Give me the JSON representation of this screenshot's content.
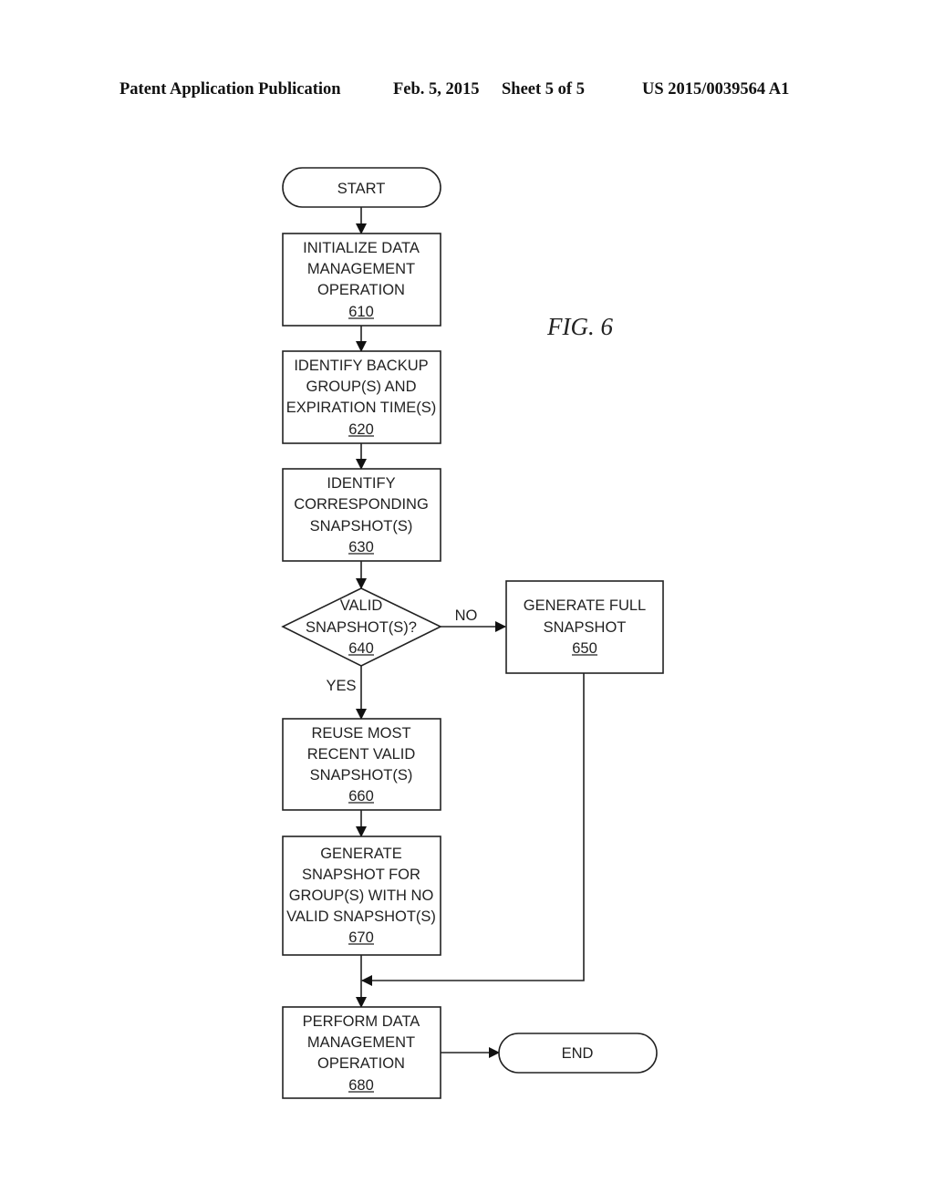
{
  "header": {
    "publication": "Patent Application Publication",
    "date": "Feb. 5, 2015",
    "sheet": "Sheet 5 of 5",
    "number": "US 2015/0039564 A1"
  },
  "figure": {
    "label": "FIG. 6"
  },
  "nodes": {
    "start": {
      "lines": [
        "START"
      ]
    },
    "n610": {
      "lines": [
        "INITIALIZE DATA",
        "MANAGEMENT",
        "OPERATION"
      ],
      "ref": "610"
    },
    "n620": {
      "lines": [
        "IDENTIFY BACKUP",
        "GROUP(S) AND",
        "EXPIRATION TIME(S)"
      ],
      "ref": "620"
    },
    "n630": {
      "lines": [
        "IDENTIFY",
        "CORRESPONDING",
        "SNAPSHOT(S)"
      ],
      "ref": "630"
    },
    "n640": {
      "lines": [
        "VALID",
        "SNAPSHOT(S)?"
      ],
      "ref": "640"
    },
    "n650": {
      "lines": [
        "GENERATE FULL",
        "SNAPSHOT"
      ],
      "ref": "650"
    },
    "n660": {
      "lines": [
        "REUSE MOST",
        "RECENT VALID",
        "SNAPSHOT(S)"
      ],
      "ref": "660"
    },
    "n670": {
      "lines": [
        "GENERATE",
        "SNAPSHOT FOR",
        "GROUP(S) WITH NO",
        "VALID SNAPSHOT(S)"
      ],
      "ref": "670"
    },
    "n680": {
      "lines": [
        "PERFORM DATA",
        "MANAGEMENT",
        "OPERATION"
      ],
      "ref": "680"
    },
    "end": {
      "lines": [
        "END"
      ]
    }
  },
  "edges": {
    "no_label": "NO",
    "yes_label": "YES"
  }
}
